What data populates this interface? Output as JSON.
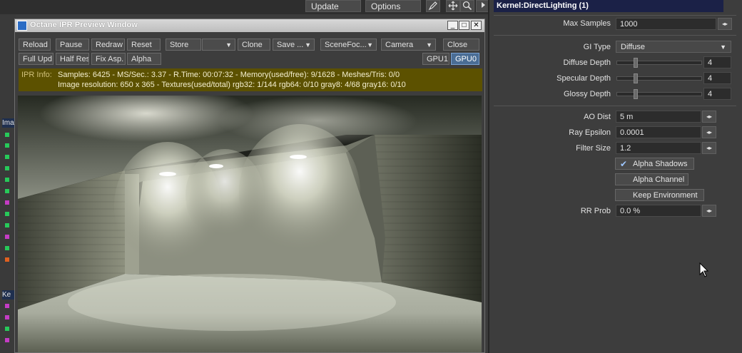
{
  "host_toolbar": {
    "update_label": "Update",
    "options_label": "Options"
  },
  "ipr_window": {
    "title": "Octane IPR Preview Window",
    "toolbar_row1": [
      "Reload",
      "Pause",
      "Redraw",
      "Reset",
      "Store",
      "",
      "Clone",
      "Save ...",
      "SceneFoc...",
      "Camera",
      "Close"
    ],
    "toolbar_row2": [
      "Full Upd.",
      "Half Res",
      "Fix Asp.",
      "Alpha"
    ],
    "gpu_buttons": [
      "GPU1",
      "GPU0"
    ],
    "active_gpu": "GPU0",
    "info_label": "IPR Info:",
    "info_line1": "Samples: 6425  -  MS/Sec.: 3.37  -  R.Time: 00:07:32 - Memory(used/free): 9/1628  -  Meshes/Tris: 0/0",
    "info_line2": "Image resolution: 650 x 365 - Textures(used/total) rgb32: 1/144   rgb64: 0/10   gray8: 4/68   gray16: 0/10"
  },
  "left_strip": {
    "head1": "Ima",
    "head2": "Ke"
  },
  "panel": {
    "title": "Kernel:DirectLighting (1)",
    "max_samples": {
      "label": "Max Samples",
      "value": "1000"
    },
    "gi_type": {
      "label": "GI Type",
      "value": "Diffuse"
    },
    "diffuse_depth": {
      "label": "Diffuse Depth",
      "value": "4"
    },
    "specular_depth": {
      "label": "Specular Depth",
      "value": "4"
    },
    "glossy_depth": {
      "label": "Glossy Depth",
      "value": "4"
    },
    "ao_dist": {
      "label": "AO Dist",
      "value": "5 m"
    },
    "ray_epsilon": {
      "label": "Ray Epsilon",
      "value": "0.0001"
    },
    "filter_size": {
      "label": "Filter Size",
      "value": "1.2"
    },
    "alpha_shadows": {
      "label": "Alpha Shadows",
      "checked": true
    },
    "alpha_channel": {
      "label": "Alpha Channel",
      "checked": false
    },
    "keep_environment": {
      "label": "Keep Environment",
      "checked": false
    },
    "rr_prob": {
      "label": "RR Prob",
      "value": "0.0 %"
    }
  },
  "colors": {
    "panel_title_bg": "#1b2147",
    "info_bar_bg": "#5c5100",
    "active_gpu_bg": "#4a6d95"
  }
}
